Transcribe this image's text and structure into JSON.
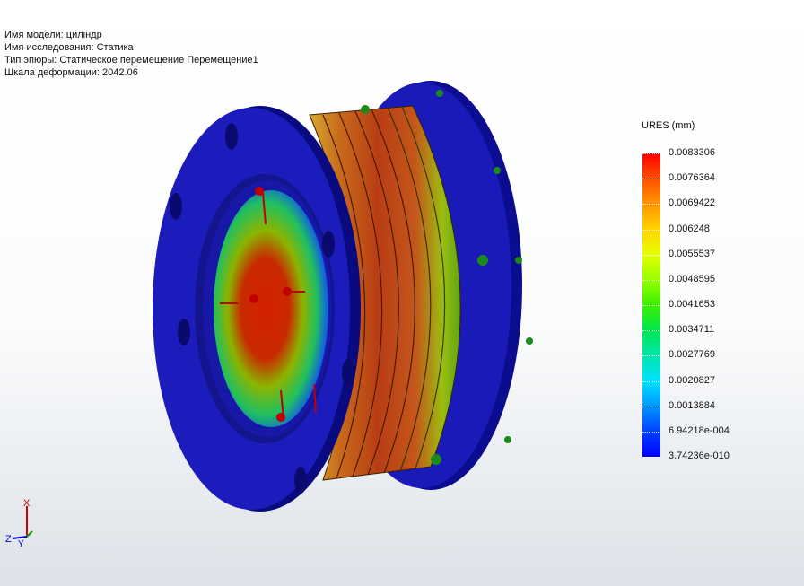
{
  "info": {
    "model_name": "Имя модели: цилiндр",
    "study_name": "Имя  исследования: Статика",
    "plot_type": "Тип эпюры: Статическое перемещение Перемещение1",
    "deformation_scale": "Шкала деформации: 2042.06"
  },
  "legend": {
    "title": "URES (mm)",
    "values": [
      "0.0083306",
      "0.0076364",
      "0.0069422",
      "0.006248",
      "0.0055537",
      "0.0048595",
      "0.0041653",
      "0.0034711",
      "0.0027769",
      "0.0020827",
      "0.0013884",
      "6.94218e-004",
      "3.74236e-010"
    ]
  },
  "triad": {
    "x": "X",
    "y": "Y",
    "z": "Z"
  },
  "colors": {
    "flange": "#1a1ab8",
    "max": "#ff0000",
    "min": "#0000ff"
  }
}
